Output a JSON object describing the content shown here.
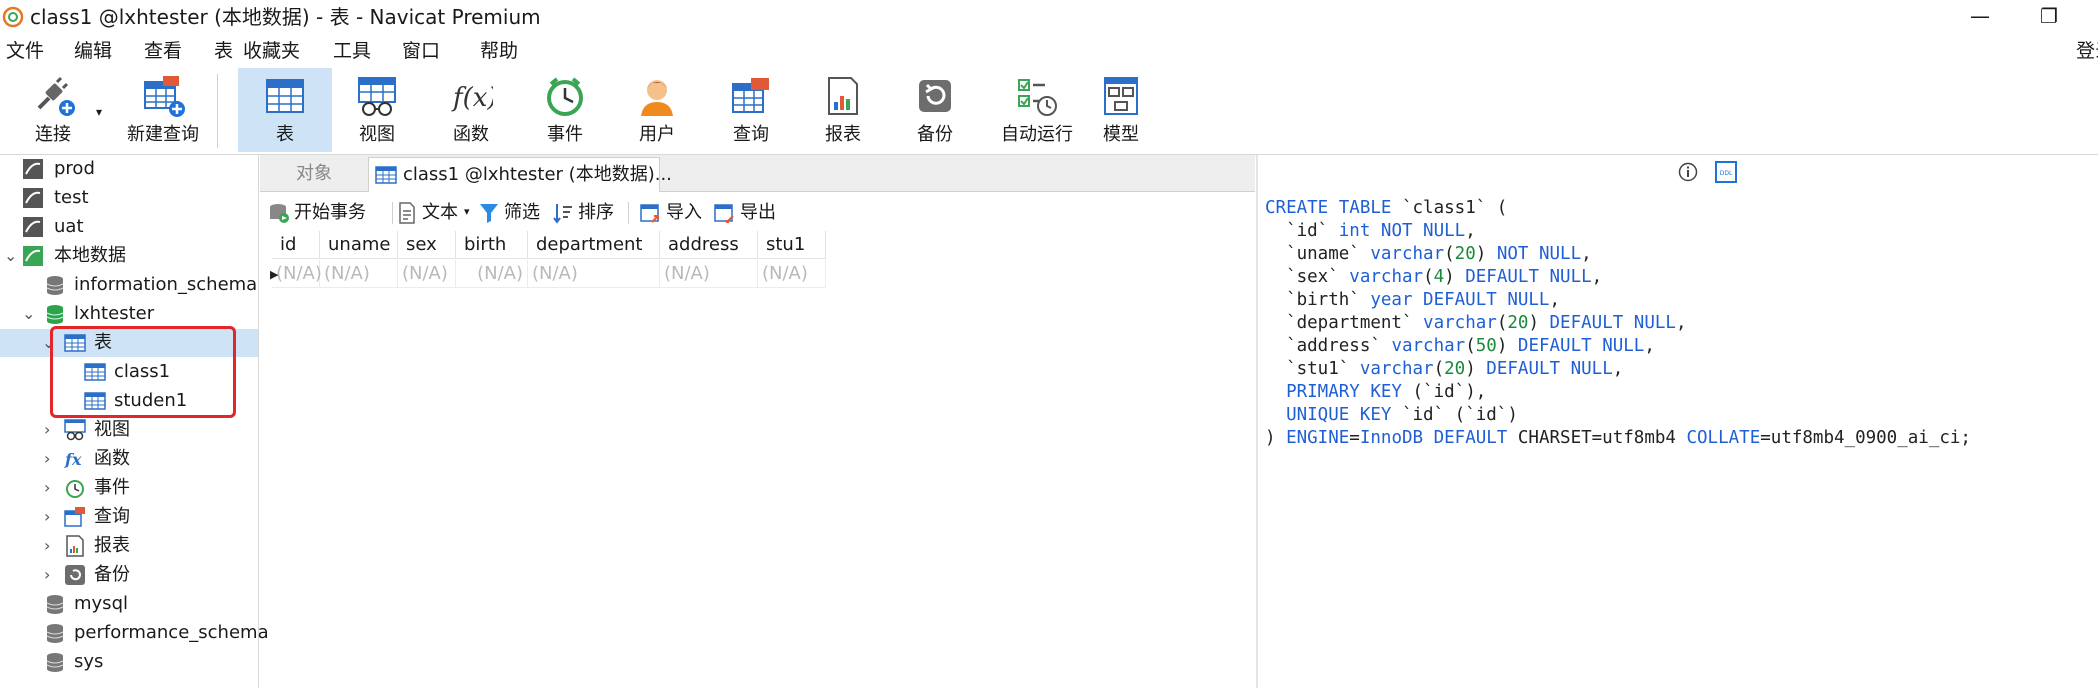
{
  "window": {
    "title": "class1 @lxhtester (本地数据) - 表 - Navicat Premium",
    "minimize": "—",
    "restore": "❐"
  },
  "menu": [
    "文件",
    "编辑",
    "查看",
    "表",
    "收藏夹",
    "工具",
    "窗口",
    "帮助"
  ],
  "menu_login": "登录",
  "toolbar": [
    {
      "label": "连接",
      "icon": "connection-plug-icon"
    },
    {
      "label": "新建查询",
      "icon": "new-query-icon"
    },
    {
      "label": "表",
      "icon": "table-icon",
      "active": true
    },
    {
      "label": "视图",
      "icon": "view-icon"
    },
    {
      "label": "函数",
      "icon": "function-icon",
      "glyph": "f(x)"
    },
    {
      "label": "事件",
      "icon": "event-clock-icon"
    },
    {
      "label": "用户",
      "icon": "user-icon"
    },
    {
      "label": "查询",
      "icon": "query-icon"
    },
    {
      "label": "报表",
      "icon": "report-icon"
    },
    {
      "label": "备份",
      "icon": "backup-icon"
    },
    {
      "label": "自动运行",
      "icon": "automation-icon"
    },
    {
      "label": "模型",
      "icon": "model-icon"
    }
  ],
  "sidebar": {
    "tree": [
      {
        "label": "prod",
        "icon": "mysql-connection-icon"
      },
      {
        "label": "test",
        "icon": "mysql-connection-icon"
      },
      {
        "label": "uat",
        "icon": "mysql-connection-icon"
      },
      {
        "label": "本地数据",
        "icon": "mysql-connection-active-icon",
        "expanded": true
      },
      {
        "label": "information_schema",
        "icon": "database-icon"
      },
      {
        "label": "lxhtester",
        "icon": "database-active-icon",
        "expanded": true
      },
      {
        "label": "表",
        "icon": "table-folder-icon",
        "expanded": true,
        "selected": true
      },
      {
        "label": "class1",
        "icon": "table-icon"
      },
      {
        "label": "studen1",
        "icon": "table-icon"
      },
      {
        "label": "视图",
        "icon": "view-icon"
      },
      {
        "label": "函数",
        "icon": "function-icon"
      },
      {
        "label": "事件",
        "icon": "event-icon"
      },
      {
        "label": "查询",
        "icon": "query-icon"
      },
      {
        "label": "报表",
        "icon": "report-icon"
      },
      {
        "label": "备份",
        "icon": "backup-icon"
      },
      {
        "label": "mysql",
        "icon": "database-icon"
      },
      {
        "label": "performance_schema",
        "icon": "database-icon"
      },
      {
        "label": "sys",
        "icon": "database-icon"
      }
    ]
  },
  "tabs": {
    "objects": "对象",
    "active": "class1 @lxhtester (本地数据)..."
  },
  "actions": {
    "begin_transaction": "开始事务",
    "text": "文本",
    "filter": "筛选",
    "sort": "排序",
    "import": "导入",
    "export": "导出"
  },
  "grid": {
    "columns": [
      "id",
      "uname",
      "sex",
      "birth",
      "department",
      "address",
      "stu1"
    ],
    "rows": [
      [
        "(N/A)",
        "(N/A)",
        "(N/A)",
        "(N/A)",
        "(N/A)",
        "(N/A)",
        "(N/A)"
      ]
    ]
  },
  "ddl": {
    "lines": [
      "CREATE TABLE `class1` (",
      "  `id` int NOT NULL,",
      "  `uname` varchar(20) NOT NULL,",
      "  `sex` varchar(4) DEFAULT NULL,",
      "  `birth` year DEFAULT NULL,",
      "  `department` varchar(20) DEFAULT NULL,",
      "  `address` varchar(50) DEFAULT NULL,",
      "  `stu1` varchar(20) DEFAULT NULL,",
      "  PRIMARY KEY (`id`),",
      "  UNIQUE KEY `id` (`id`)",
      ") ENGINE=InnoDB DEFAULT CHARSET=utf8mb4 COLLATE=utf8mb4_0900_ai_ci;"
    ],
    "ddl_badge": "DDL"
  },
  "colors": {
    "keyword": "#1f5fd6",
    "number": "#1a8a3a",
    "selection": "#cfe3f7",
    "highlight_box": "#e3262b"
  }
}
